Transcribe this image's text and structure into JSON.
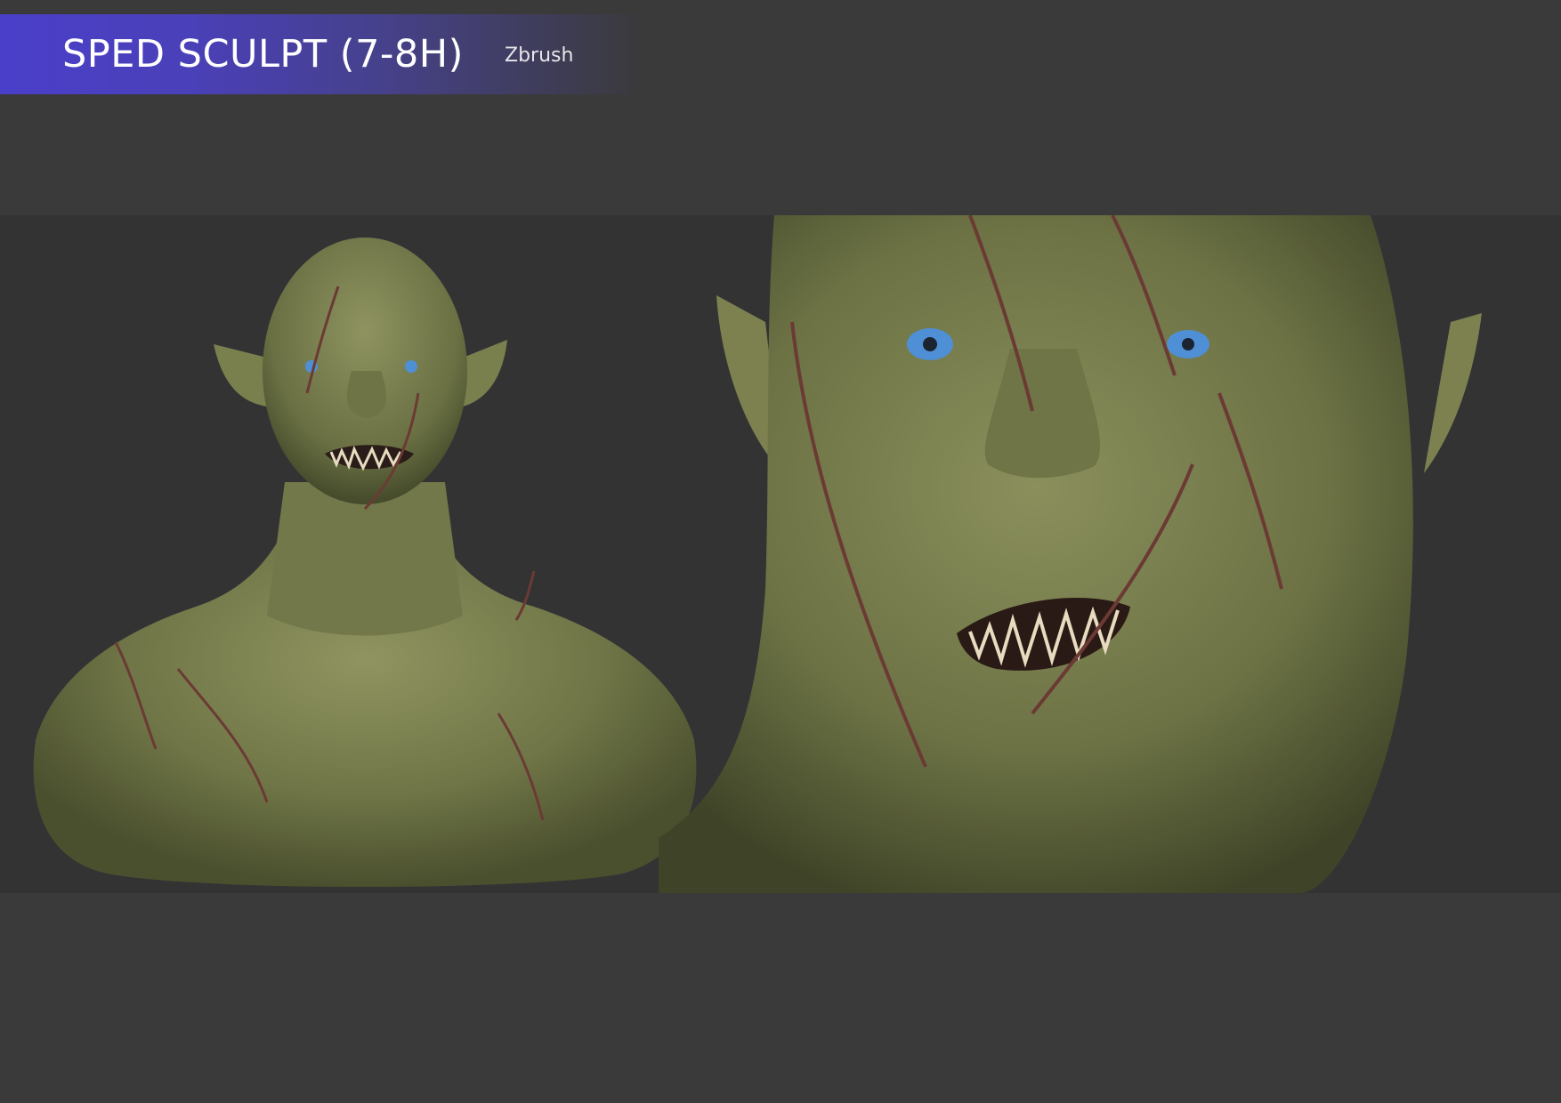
{
  "header": {
    "title": "SPED SCULPT (7-8H)",
    "software": "Zbrush",
    "accent_color": "#4a3fc9"
  },
  "renders": [
    {
      "subject": "orc-bust-full-view"
    },
    {
      "subject": "orc-face-closeup"
    }
  ],
  "colors": {
    "background": "#3a3a3b",
    "render_band": "#333334",
    "skin": "#7f8452",
    "eyes": "#4f8fd6"
  }
}
